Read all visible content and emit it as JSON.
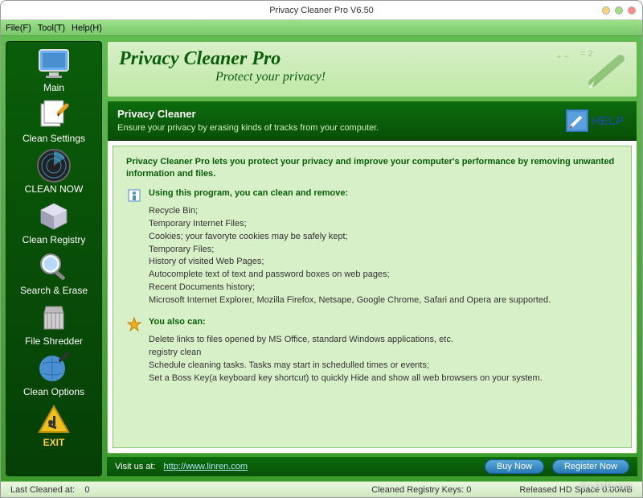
{
  "window": {
    "title": "Privacy Cleaner Pro V6.50"
  },
  "menu": {
    "file": "File(F)",
    "tool": "Tool(T)",
    "help": "Help(H)"
  },
  "sidebar": [
    {
      "label": "Main"
    },
    {
      "label": "Clean Settings"
    },
    {
      "label": "CLEAN NOW"
    },
    {
      "label": "Clean Registry"
    },
    {
      "label": "Search & Erase"
    },
    {
      "label": "File Shredder"
    },
    {
      "label": "Clean Options"
    },
    {
      "label": "EXIT"
    }
  ],
  "banner": {
    "title": "Privacy Cleaner Pro",
    "subtitle": "Protect your privacy!"
  },
  "section": {
    "title": "Privacy Cleaner",
    "desc": "Ensure your privacy by erasing kinds of tracks from your computer.",
    "help": "HELP"
  },
  "content": {
    "intro": "Privacy Cleaner Pro lets you protect your privacy and improve your computer's performance by removing unwanted information and files.",
    "head1": "Using this program, you can clean and remove:",
    "list1": [
      "Recycle Bin;",
      "Temporary Internet Files;",
      "Cookies; your favoryte cookies may be safely kept;",
      "Temporary Files;",
      "History of visited Web Pages;",
      "Autocomplete text of text and password boxes on web pages;",
      "Recent Documents history;",
      "Microsoft Internet Explorer, Mozilla Firefox, Netsape, Google Chrome, Safari and Opera are supported."
    ],
    "head2": "You also can:",
    "list2": [
      "Delete links to files opened by MS Office, standard Windows applications, etc.",
      "registry clean",
      "Schedule cleaning tasks. Tasks may start in schedulled times or events;",
      "Set a Boss Key(a keyboard key shortcut) to quickly Hide and show all web browsers on your system."
    ]
  },
  "footer": {
    "visit_prefix": "Visit us at: ",
    "visit_url": "http://www.linren.com",
    "buy": "Buy Now",
    "register": "Register Now"
  },
  "status": {
    "last_cleaned_label": "Last Cleaned at:",
    "last_cleaned_value": "0",
    "registry_label": "Cleaned Registry Keys:",
    "registry_value": "0",
    "hd_label": "Released HD Space",
    "hd_value": "0.00MB"
  },
  "watermark": "© LO4D.com"
}
